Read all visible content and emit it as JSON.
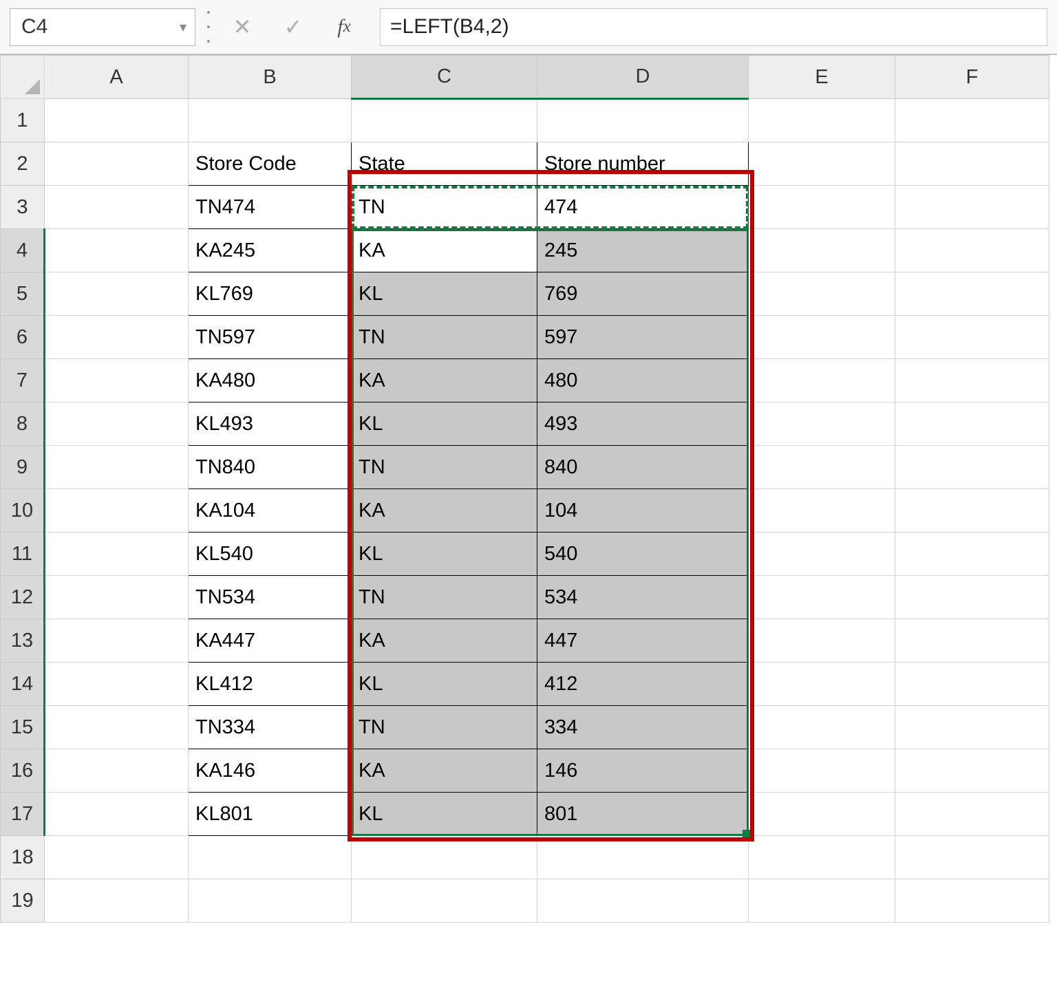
{
  "formula_bar": {
    "name_box": "C4",
    "formula": "=LEFT(B4,2)"
  },
  "columns": [
    "A",
    "B",
    "C",
    "D",
    "E",
    "F"
  ],
  "table": {
    "headers": {
      "store_code": "Store Code",
      "state": "State",
      "store_number": "Store number"
    },
    "rows": [
      {
        "code": "TN474",
        "state": "TN",
        "num": "474"
      },
      {
        "code": "KA245",
        "state": "KA",
        "num": "245"
      },
      {
        "code": "KL769",
        "state": "KL",
        "num": "769"
      },
      {
        "code": "TN597",
        "state": "TN",
        "num": "597"
      },
      {
        "code": "KA480",
        "state": "KA",
        "num": "480"
      },
      {
        "code": "KL493",
        "state": "KL",
        "num": "493"
      },
      {
        "code": "TN840",
        "state": "TN",
        "num": "840"
      },
      {
        "code": "KA104",
        "state": "KA",
        "num": "104"
      },
      {
        "code": "KL540",
        "state": "KL",
        "num": "540"
      },
      {
        "code": "TN534",
        "state": "TN",
        "num": "534"
      },
      {
        "code": "KA447",
        "state": "KA",
        "num": "447"
      },
      {
        "code": "KL412",
        "state": "KL",
        "num": "412"
      },
      {
        "code": "TN334",
        "state": "TN",
        "num": "334"
      },
      {
        "code": "KA146",
        "state": "KA",
        "num": "146"
      },
      {
        "code": "KL801",
        "state": "KL",
        "num": "801"
      }
    ]
  }
}
